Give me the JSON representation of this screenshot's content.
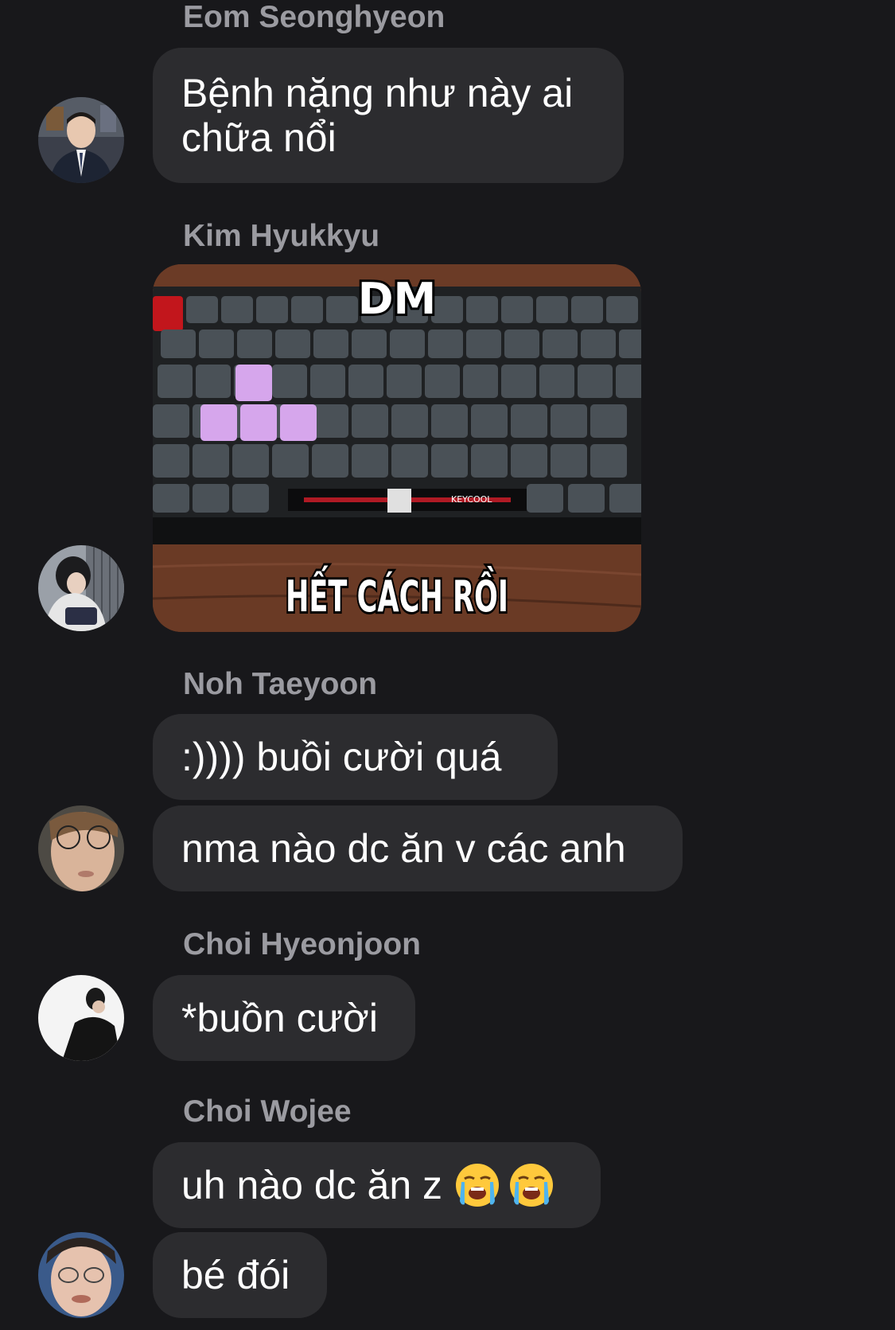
{
  "messages": [
    {
      "sender": "Eom Seonghyeon",
      "lines": [
        "Bệnh nặng như này ai",
        "chữa nổi"
      ]
    },
    {
      "sender": "Kim Hyukkyu",
      "image": {
        "top_text": "DM",
        "bottom_text": "HẾT CÁCH RỒI",
        "keyboard_brand": "KEYCOOL"
      }
    },
    {
      "sender": "Noh Taeyoon",
      "texts": [
        ":)))) buồi cười quá",
        "nma nào dc ăn v các anh"
      ]
    },
    {
      "sender": "Choi Hyeonjoon",
      "texts": [
        "*buồn cười"
      ]
    },
    {
      "sender": "Choi Wojee",
      "texts": [
        "uh nào dc ăn z",
        "bé đói"
      ],
      "emojis": [
        "loudly-crying-face",
        "loudly-crying-face"
      ]
    }
  ],
  "colors": {
    "background": "#18181b",
    "bubble": "#2c2c2f",
    "sender_name": "#9b9ba1",
    "text": "#ffffff"
  }
}
